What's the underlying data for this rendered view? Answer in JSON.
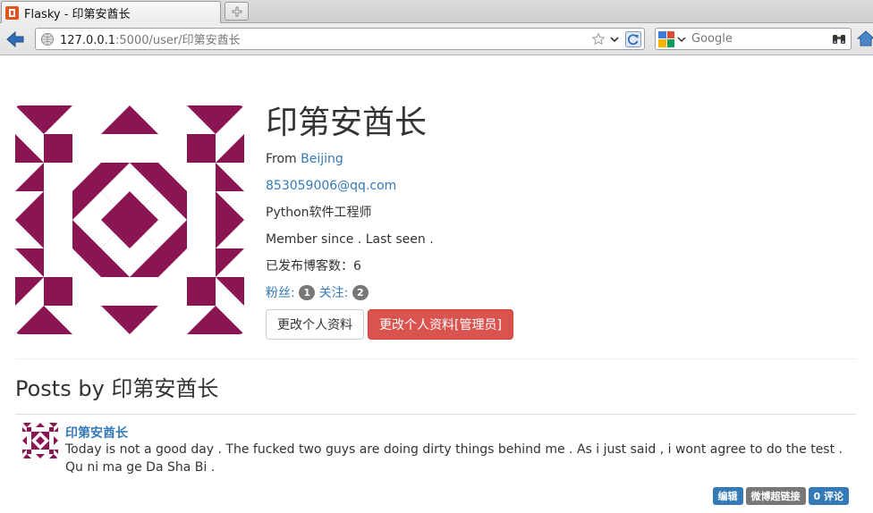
{
  "browser": {
    "tab_title": "Flasky - 印第安酋长",
    "url_host": "127.0.0.1",
    "url_rest": ":5000/user/印第安酋长",
    "search_placeholder": "Google"
  },
  "profile": {
    "username": "印第安酋长",
    "from_label": "From",
    "location": "Beijing",
    "email": "853059006@qq.com",
    "about": "Python软件工程师",
    "member_since": "Member since . Last seen .",
    "post_count": "已发布博客数：6",
    "followers_label": "粉丝:",
    "followers_count": "1",
    "following_label": "关注:",
    "following_count": "2",
    "edit_profile_button": "更改个人资料",
    "edit_profile_admin_button": "更改个人资料[管理员]"
  },
  "posts_heading": "Posts by 印第安酋长",
  "posts": [
    {
      "author": "印第安酋长",
      "body": "Today is not a good day . The fucked two guys are doing dirty things behind me . As i just said , i wont agree to do the test . Qu ni ma ge Da Sha Bi .",
      "edit_label": "编辑",
      "weibo_label": "微博超链接",
      "comments_label": "0 评论"
    }
  ],
  "colors": {
    "identicon": "#8b1452",
    "link": "#337ab7",
    "danger": "#d9534f",
    "badge": "#777777"
  }
}
